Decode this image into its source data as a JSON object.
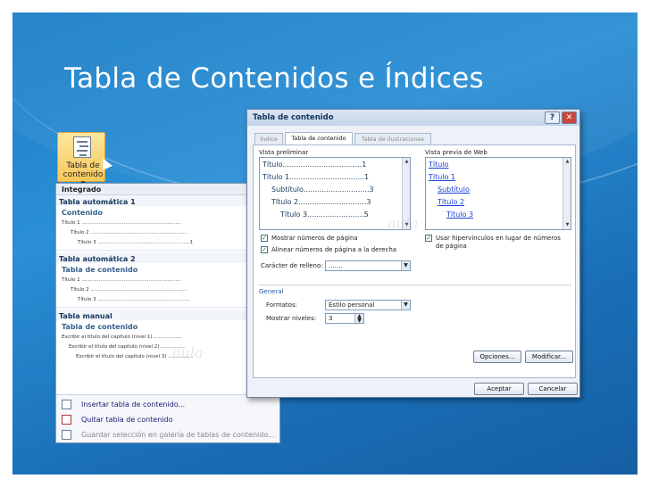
{
  "slide": {
    "title": "Tabla de Contenidos e Índices"
  },
  "ribbon": {
    "button_label_1": "Tabla de",
    "button_label_2": "contenido ▾"
  },
  "gallery": {
    "header": "Integrado",
    "sections": [
      {
        "name": "Tabla automática 1",
        "heading": "Contenido",
        "lines": [
          "Título 1 ................................................................",
          "Título 2 ..............................................................",
          "Título 3 ...........................................................1"
        ]
      },
      {
        "name": "Tabla automática 2",
        "heading": "Tabla de contenido",
        "lines": [
          "Título 1 ................................................................",
          "Título 2 ..............................................................",
          "Título 3 ..........................................................."
        ]
      },
      {
        "name": "Tabla manual",
        "heading": "Tabla de contenido",
        "lines": [
          "Escribir el título del capítulo (nivel 1) ..................",
          "Escribir el título del capítulo (nivel 2).................",
          "Escribir el título del capítulo (nivel 3) ................"
        ]
      }
    ],
    "menu": [
      "Insertar tabla de contenido...",
      "Quitar tabla de contenido",
      "Guardar selección en galería de tablas de contenido..."
    ]
  },
  "dialog": {
    "title": "Tabla de contenido",
    "help": "?",
    "close": "✕",
    "tabs": [
      "Índice",
      "Tabla de contenido",
      "Tabla de ilustraciones"
    ],
    "print_preview_label": "Vista preliminar",
    "web_preview_label": "Vista previa de Web",
    "print_preview": [
      "Título...................................1",
      "Título 1.................................1",
      "Subtítulo.............................3",
      "Título 2..............................3",
      "Título 3.........................5"
    ],
    "web_preview": [
      "Título",
      "Título 1",
      "Subtítulo",
      "Título 2",
      "Título 3"
    ],
    "show_page_numbers": "Mostrar números de página",
    "align_right": "Alinear números de página a la derecha",
    "use_hyperlinks": "Usar hipervínculos en lugar de números de página",
    "fill_char_label": "Carácter de relleno:",
    "fill_char_value": ".......",
    "general_label": "General",
    "formats_label": "Formatos:",
    "formats_value": "Estilo personal",
    "levels_label": "Mostrar niveles:",
    "levels_value": "3",
    "options_button": "Opciones...",
    "modify_button": "Modificar...",
    "accept_button": "Aceptar",
    "cancel_button": "Cancelar"
  }
}
